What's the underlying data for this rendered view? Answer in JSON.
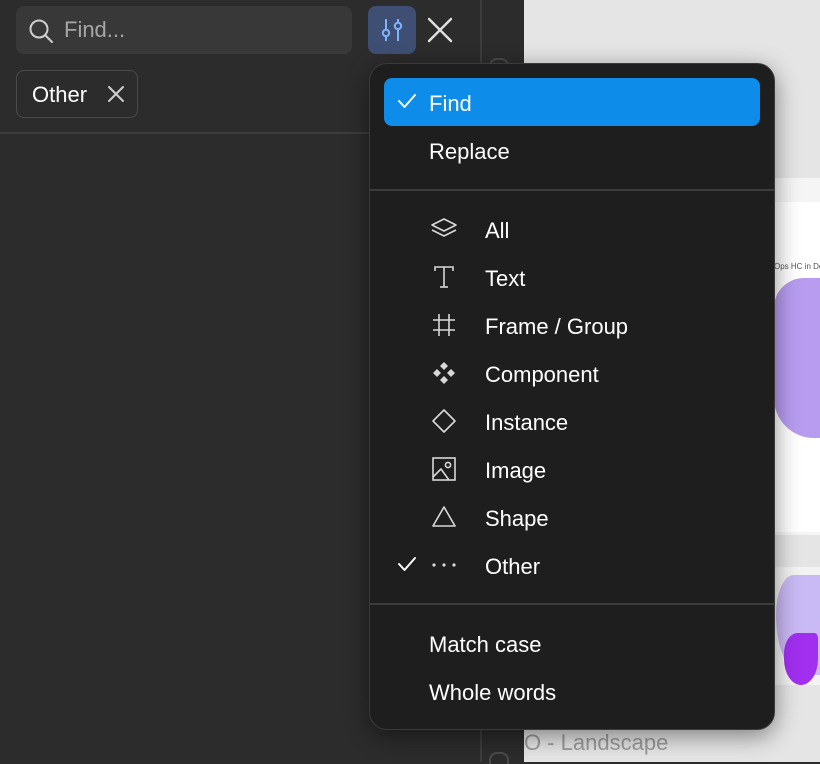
{
  "search": {
    "placeholder": "Find..."
  },
  "filter_chip": {
    "label": "Other"
  },
  "canvas": {
    "frame_caption": "Ops HC in Des",
    "frame_label": "O - Landscape"
  },
  "menu": {
    "modes": [
      {
        "label": "Find",
        "checked": true
      },
      {
        "label": "Replace",
        "checked": false
      }
    ],
    "types": [
      {
        "label": "All",
        "icon": "layers-icon",
        "checked": false
      },
      {
        "label": "Text",
        "icon": "text-icon",
        "checked": false
      },
      {
        "label": "Frame / Group",
        "icon": "frame-icon",
        "checked": false
      },
      {
        "label": "Component",
        "icon": "component-icon",
        "checked": false
      },
      {
        "label": "Instance",
        "icon": "instance-icon",
        "checked": false
      },
      {
        "label": "Image",
        "icon": "image-icon",
        "checked": false
      },
      {
        "label": "Shape",
        "icon": "shape-icon",
        "checked": false
      },
      {
        "label": "Other",
        "icon": "more-icon",
        "checked": true
      }
    ],
    "options": [
      {
        "label": "Match case"
      },
      {
        "label": "Whole words"
      }
    ]
  },
  "colors": {
    "accent": "#0d8ce9",
    "panel": "#2c2c2c",
    "menu": "#1e1e1e"
  }
}
